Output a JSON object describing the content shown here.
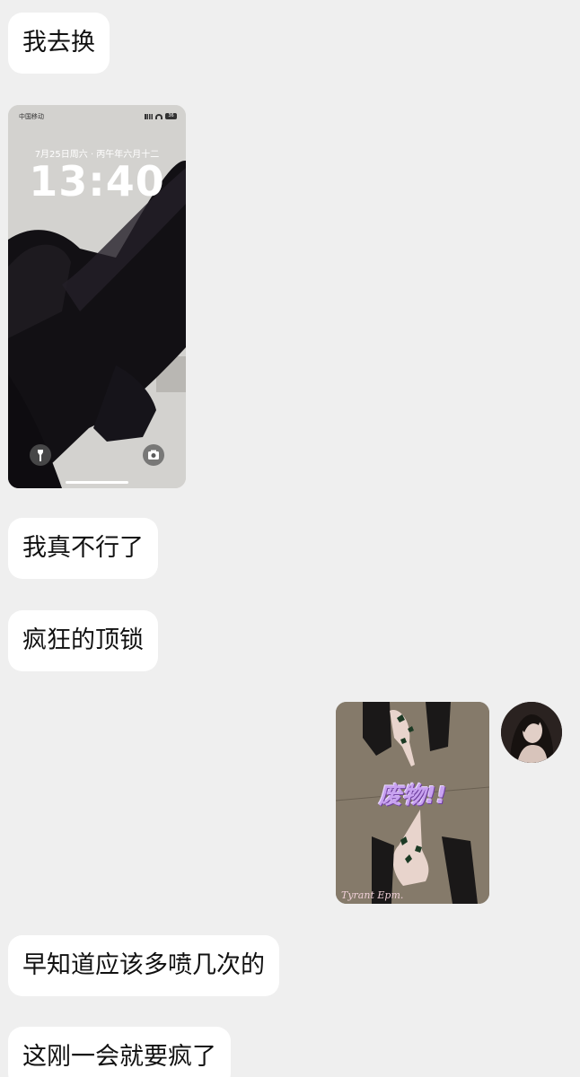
{
  "messages": [
    {
      "type": "text",
      "side": "left",
      "text": "我去换"
    },
    {
      "type": "image",
      "side": "left",
      "lockscreen": {
        "carrier": "中国移动",
        "battery": "36",
        "date": "7月25日周六 · 丙午年六月十二",
        "time": "13:40",
        "flash_icon": "flashlight-icon",
        "camera_icon": "camera-icon"
      }
    },
    {
      "type": "text",
      "side": "left",
      "text": "我真不行了"
    },
    {
      "type": "text",
      "side": "left",
      "text": "疯狂的顶锁"
    },
    {
      "type": "image",
      "side": "right",
      "overlay_text": "废物!!",
      "watermark": "Tyrant Epm."
    },
    {
      "type": "text",
      "side": "left",
      "text": "早知道应该多喷几次的"
    },
    {
      "type": "text",
      "side": "left",
      "text": "这刚一会就要疯了"
    }
  ],
  "colors": {
    "background": "#efefef",
    "bubble": "#ffffff",
    "text": "#111111"
  }
}
